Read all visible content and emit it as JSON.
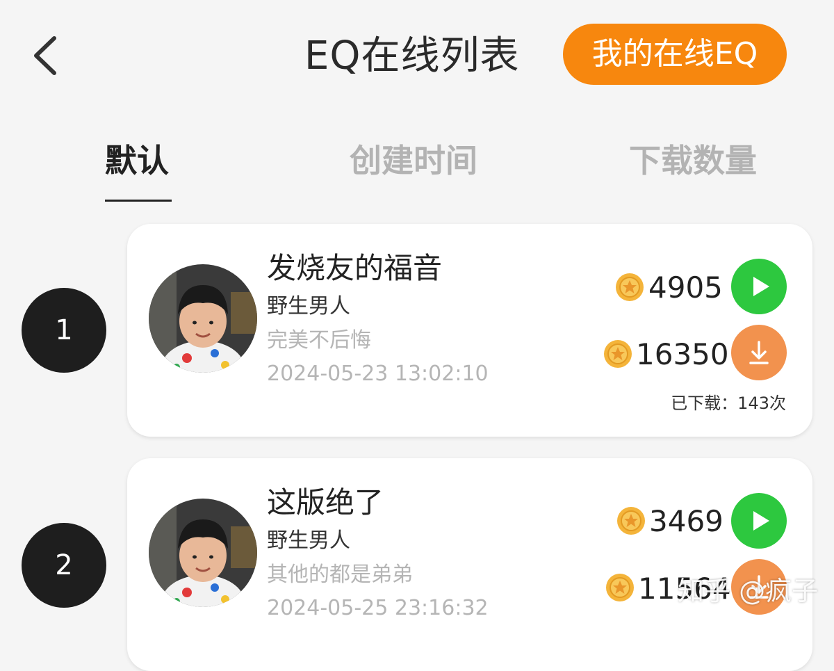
{
  "header": {
    "title": "EQ在线列表",
    "my_eq_button": "我的在线EQ",
    "back_icon": "chevron-left-icon"
  },
  "tabs": [
    {
      "label": "默认",
      "active": true
    },
    {
      "label": "创建时间",
      "active": false
    },
    {
      "label": "下载数量",
      "active": false
    }
  ],
  "colors": {
    "accent": "#f7870e",
    "play": "#2dc83f",
    "download": "#f2924e",
    "rank_bg": "#1e1e1e"
  },
  "items": [
    {
      "rank": "1",
      "name": "发烧友的福音",
      "author": "野生男人",
      "description": "完美不后悔",
      "date": "2024-05-23 13:02:10",
      "price1": "4905",
      "price2": "16350",
      "downloads": "已下载：143次"
    },
    {
      "rank": "2",
      "name": "这版绝了",
      "author": "野生男人",
      "description": "其他的都是弟弟",
      "date": "2024-05-25 23:16:32",
      "price1": "3469",
      "price2": "11564",
      "downloads": ""
    }
  ],
  "watermark": "知乎 @疯子"
}
